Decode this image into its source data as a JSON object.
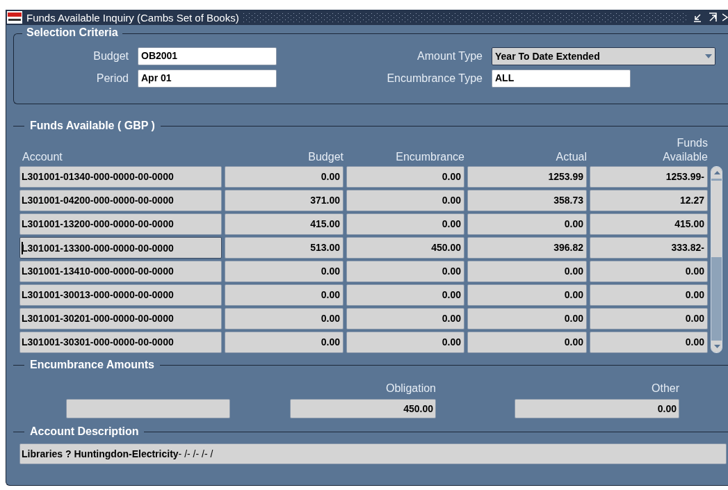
{
  "window": {
    "title": "Funds Available Inquiry (Cambs Set of Books)"
  },
  "selection_criteria": {
    "title": "Selection Criteria",
    "fields": [
      {
        "label": "Budget",
        "value": "OB2001",
        "kind": "text"
      },
      {
        "label": "Amount Type",
        "value": "Year To Date Extended",
        "kind": "dropdown"
      },
      {
        "label": "Period",
        "value": "Apr 01",
        "kind": "text"
      },
      {
        "label": "Encumbrance Type",
        "value": "ALL",
        "kind": "text"
      }
    ]
  },
  "funds_available": {
    "title": "Funds Available ( GBP )",
    "columns": [
      "Account",
      "Budget",
      "Encumbrance",
      "Actual",
      "Funds Available"
    ],
    "rows": [
      {
        "cells": [
          "L301001-01340-000-0000-00-0000",
          "0.00",
          "0.00",
          "1253.99",
          "1253.99-"
        ],
        "focused": false
      },
      {
        "cells": [
          "L301001-04200-000-0000-00-0000",
          "371.00",
          "0.00",
          "358.73",
          "12.27"
        ],
        "focused": false
      },
      {
        "cells": [
          "L301001-13200-000-0000-00-0000",
          "415.00",
          "0.00",
          "0.00",
          "415.00"
        ],
        "focused": false
      },
      {
        "cells": [
          "L301001-13300-000-0000-00-0000",
          "513.00",
          "450.00",
          "396.82",
          "333.82-"
        ],
        "focused": true
      },
      {
        "cells": [
          "L301001-13410-000-0000-00-0000",
          "0.00",
          "0.00",
          "0.00",
          "0.00"
        ],
        "focused": false
      },
      {
        "cells": [
          "L301001-30013-000-0000-00-0000",
          "0.00",
          "0.00",
          "0.00",
          "0.00"
        ],
        "focused": false
      },
      {
        "cells": [
          "L301001-30201-000-0000-00-0000",
          "0.00",
          "0.00",
          "0.00",
          "0.00"
        ],
        "focused": false
      },
      {
        "cells": [
          "L301001-30301-000-0000-00-0000",
          "0.00",
          "0.00",
          "0.00",
          "0.00"
        ],
        "focused": false
      }
    ]
  },
  "encumbrance_amounts": {
    "title": "Encumbrance Amounts",
    "fields": [
      {
        "label": "Obligation",
        "value": "450.00"
      },
      {
        "label": "Other",
        "value": "0.00"
      }
    ]
  },
  "account_description": {
    "title": "Account Description",
    "value": "**Libraries ? Huntingdon-Electricity**- /- /- /- /"
  }
}
